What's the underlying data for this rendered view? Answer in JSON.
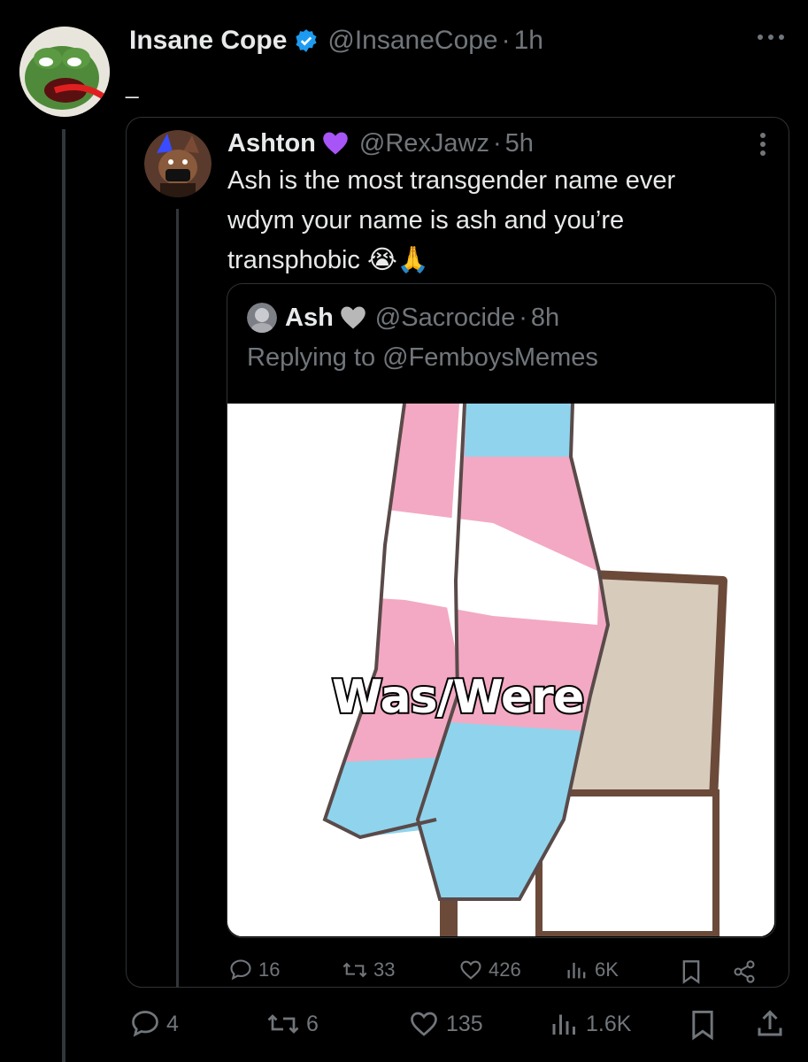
{
  "main_tweet": {
    "display_name": "Insane Cope",
    "handle": "@InsaneCope",
    "time": "1h",
    "text": "_",
    "actions": {
      "replies": "4",
      "reposts": "6",
      "likes": "135",
      "views": "1.6K"
    }
  },
  "quoted_tweet": {
    "display_name": "Ashton",
    "handle": "@RexJawz",
    "time": "5h",
    "text_lines": [
      "Ash is the most transgender name ever",
      "wdym your name is ash and you’re",
      "transphobic"
    ],
    "emoji": "😭🙏",
    "actions": {
      "replies": "16",
      "reposts": "33",
      "likes": "426",
      "views": "6K"
    }
  },
  "nested_quote": {
    "display_name": "Ash",
    "handle": "@Sacrocide",
    "time": "8h",
    "replying_to": "Replying to @FemboysMemes",
    "image_caption": "Was/Were"
  },
  "colors": {
    "background": "#000000",
    "verified": "#1d9bf0",
    "purple_heart": "#a855f7",
    "grey_heart": "#b8b8b8",
    "trans_blue": "#8fd4ec",
    "trans_pink": "#f3a9c3"
  },
  "icons": [
    "more-icon",
    "verified-icon",
    "purple-heart-icon",
    "grey-heart-icon",
    "reply-icon",
    "repost-icon",
    "like-icon",
    "views-icon",
    "bookmark-icon",
    "share-icon"
  ]
}
